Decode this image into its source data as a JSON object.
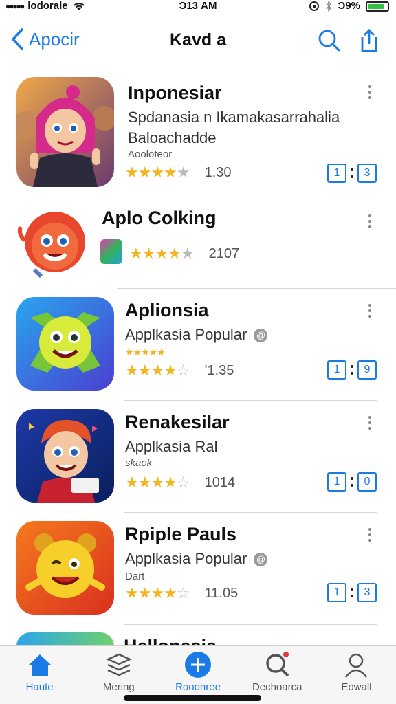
{
  "status_bar": {
    "carrier": "lodorale",
    "time": "Ͻ13 AM",
    "battery": "Ͻ9%"
  },
  "nav": {
    "back_label": "Apocir",
    "title": "Kavd a"
  },
  "apps": [
    {
      "title": "Inponesiar",
      "subtitle": "Spdanasia n Ikamakasarrahalia",
      "subtitle2": "Baloachadde",
      "tag": "Aooloteor",
      "count": "1.30",
      "btn1": "1",
      "btn2": "3"
    },
    {
      "title": "Aplo Colking",
      "count": "2107"
    },
    {
      "title": "Aplionsia",
      "subtitle": "Applkasia Popular",
      "tag": "",
      "count": "'1.35",
      "btn1": "1",
      "btn2": "9"
    },
    {
      "title": "Renakesilar",
      "subtitle": "Applkasia Ral",
      "tag": "skaok",
      "count": "1014",
      "btn1": "1",
      "btn2": "0"
    },
    {
      "title": "Rpiple Pauls",
      "subtitle": "Applkasia Popular",
      "tag": "Dart",
      "count": "11.05",
      "btn1": "1",
      "btn2": "3"
    }
  ],
  "peek_title": "Hellonesie",
  "tabs": [
    {
      "label": "Haute",
      "icon": "home-icon",
      "active": true
    },
    {
      "label": "Mering",
      "icon": "layers-icon",
      "active": false
    },
    {
      "label": "Rooonree",
      "icon": "plus-icon",
      "active": true
    },
    {
      "label": "Dechoarca",
      "icon": "search-icon",
      "active": false
    },
    {
      "label": "Eowall",
      "icon": "person-icon",
      "active": false
    }
  ],
  "colors": {
    "accent": "#1a7ae6",
    "star": "#f2b51f",
    "battery": "#31c047"
  }
}
